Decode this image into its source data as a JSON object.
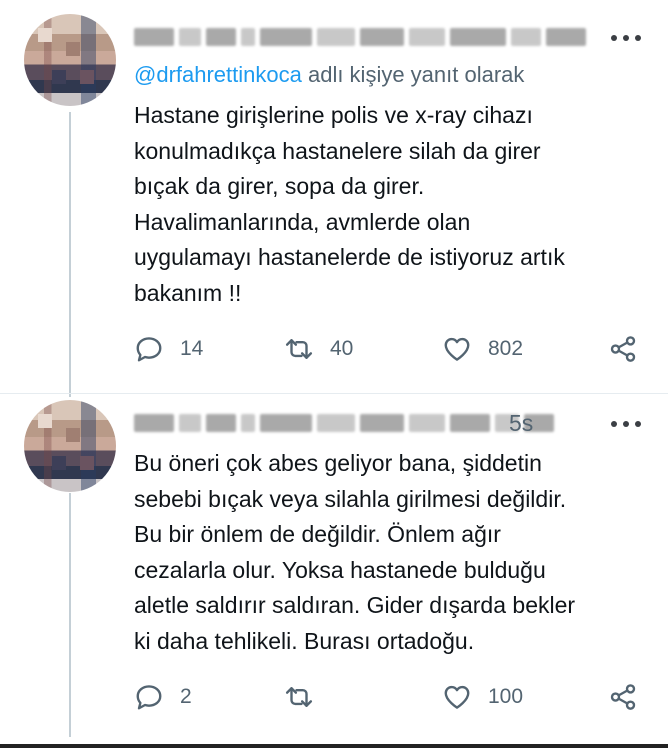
{
  "tweets": [
    {
      "avatar": "blurred-profile-photo",
      "name": "",
      "time": "",
      "replying_to": {
        "mention": "@drfahrettinkoca",
        "suffix": " adlı kişiye yanıt olarak"
      },
      "text": "Hastane girişlerine polis ve x-ray cihazı\nkonulmadıkça hastanelere silah da girer\nbıçak da girer, sopa da girer.\nHavalimanlarında, avmlerde olan\nuygulamayı hastanelerde de istiyoruz artık\nbakanım !!",
      "stats": {
        "replies": "14",
        "retweets": "40",
        "likes": "802"
      }
    },
    {
      "avatar": "blurred-profile-photo",
      "name": "",
      "time": "5s",
      "text": "Bu öneri çok abes geliyor bana, şiddetin\nsebebi bıçak veya silahla girilmesi değildir.\nBu bir önlem de değildir. Önlem ağır\ncezalarla olur. Yoksa hastanede bulduğu\naletle saldırır saldıran. Gider dışarda bekler\nki daha tehlikeli. Burası ortadoğu.",
      "stats": {
        "replies": "2",
        "retweets": "",
        "likes": "100"
      }
    }
  ],
  "icons": {
    "reply": "reply-icon",
    "retweet": "retweet-icon",
    "like": "heart-icon",
    "share": "share-icon",
    "more": "more-dots-icon"
  },
  "colors": {
    "mention": "#1d9bf0",
    "secondary": "#536471",
    "text": "#0f1419",
    "icon": "#536471"
  }
}
